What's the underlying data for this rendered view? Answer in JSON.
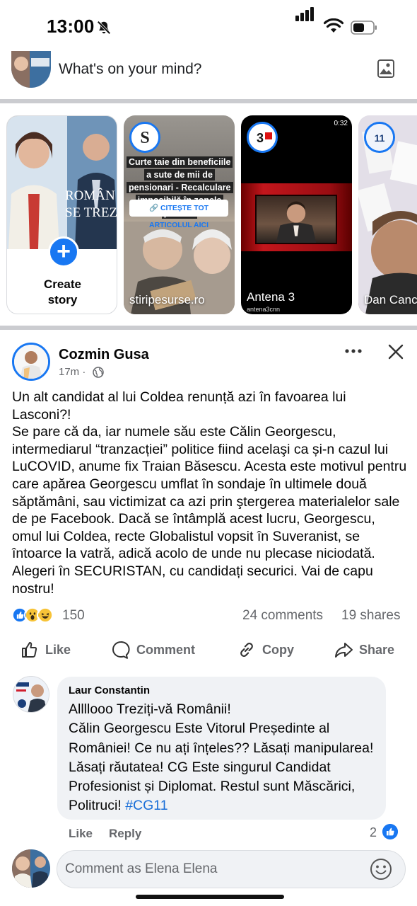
{
  "status_bar": {
    "time": "13:00"
  },
  "composer": {
    "placeholder": "What's on your mind?"
  },
  "stories": {
    "create": {
      "label_line1": "Create",
      "label_line2": "story"
    },
    "items": [
      {
        "label": "stiripesurse.ro",
        "headline": "Curte taie din beneficiile a sute de mii de pensionari - Recalculare imposibilă în zonele poluate",
        "cta": "CITEȘTE TOT ARTICOLUL AICI"
      },
      {
        "label": "Antena 3",
        "duration": "0:32",
        "subtitle": "antena3cnn"
      },
      {
        "label": "Dan Canc"
      }
    ]
  },
  "post": {
    "author": "Cozmin Gusa",
    "time": "17m",
    "separator": "·",
    "body": "Un alt candidat al lui Coldea renunță azi în favoarea lui Lasconi?!\nSe pare că da, iar numele său este Călin Georgescu, intermediarul “tranzacției” politice fiind acelaşi ca și-n cazul lui LuCOVID, anume fix Traian Băsescu. Acesta este motivul pentru care apărea Georgescu umflat în sondaje în ultimele două săptămâni, sau victimizat ca azi prin ştergerea materialelor sale de pe Facebook. Dacă se întâmplă acest lucru, Georgescu, omul lui Coldea, recte Globalistul vopsit în Suveranist, se întoarce la vatră, adică acolo de unde nu plecase niciodată. Alegeri în SECURISTAN, cu candidați securici. Vai de capu nostru!",
    "reaction_count": "150",
    "comments": "24 comments",
    "shares": "19 shares",
    "actions": {
      "like": "Like",
      "comment": "Comment",
      "copy": "Copy",
      "share": "Share"
    }
  },
  "comment": {
    "author": "Laur Constantin",
    "text": "Allllooo Treziți-vă Românii!\nCălin Georgescu Este Vitorul Președinte al României! Ce nu ați înțeles?? Lăsați manipularea! Lăsați răutatea! CG Este singurul Candidat Profesionist și Diplomat. Restul sunt Măscărici, Politruci! ",
    "hashtag": "#CG11",
    "like": "Like",
    "reply": "Reply",
    "like_count": "2"
  },
  "comment_input": {
    "placeholder": "Comment as Elena Elena"
  },
  "colors": {
    "accent": "#1877f2",
    "secondary_text": "#65676b",
    "divider": "#cbccd0"
  }
}
